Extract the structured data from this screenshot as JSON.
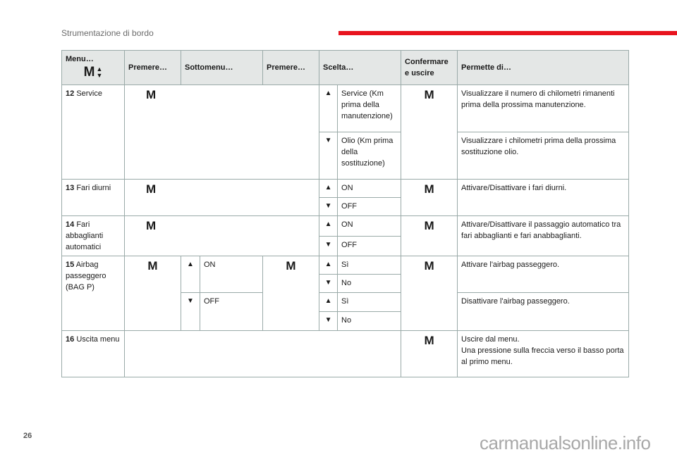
{
  "header": {
    "section_title": "Strumentazione di bordo",
    "accent_color": "#e8141e"
  },
  "table": {
    "columns": {
      "menu": "Menu…",
      "premere1": "Premere…",
      "sottomenu": "Sottomenu…",
      "premere2": "Premere…",
      "scelta": "Scelta…",
      "confermare": "Confermare e uscire",
      "permette": "Permette di…"
    },
    "icons": {
      "m": "M",
      "up": "▲",
      "down": "▼"
    },
    "rows": {
      "r12": {
        "num": "12",
        "label": "Service",
        "choices": [
          "Service (Km prima della manutenzione)",
          "Olio (Km prima della sostituzione)"
        ],
        "desc": [
          "Visualizzare il numero di chilometri rimanenti prima della prossima manutenzione.",
          "Visualizzare i chilometri prima della prossima sostituzione olio."
        ]
      },
      "r13": {
        "num": "13",
        "label": "Fari diurni",
        "choices": [
          "ON",
          "OFF"
        ],
        "desc": "Attivare/Disattivare i fari diurni."
      },
      "r14": {
        "num": "14",
        "label": "Fari abbaglianti automatici",
        "choices": [
          "ON",
          "OFF"
        ],
        "desc": "Attivare/Disattivare il passaggio automatico tra fari abbaglianti e fari anabbaglianti."
      },
      "r15": {
        "num": "15",
        "label": "Airbag passeggero (BAG P)",
        "sub": [
          "ON",
          "OFF"
        ],
        "choices": [
          "Sì",
          "No",
          "Sì",
          "No"
        ],
        "desc": [
          "Attivare l'airbag passeggero.",
          "Disattivare l'airbag passeggero."
        ]
      },
      "r16": {
        "num": "16",
        "label": "Uscita menu",
        "desc": [
          "Uscire dal menu.",
          "Una pressione sulla freccia verso il basso porta al primo menu."
        ]
      }
    }
  },
  "footer": {
    "page_number": "26",
    "watermark": "carmanualsonline.info"
  }
}
